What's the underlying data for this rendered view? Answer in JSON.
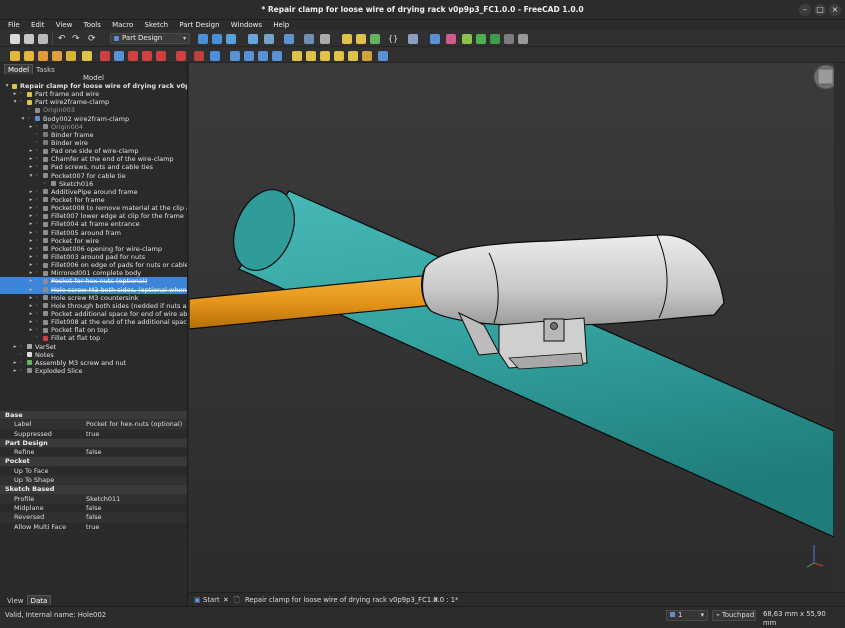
{
  "window": {
    "title": "* Repair clamp for loose wire of drying rack v0p9p3_FC1.0.0 - FreeCAD 1.0.0",
    "minimize": "–",
    "maximize": "□",
    "close": "×"
  },
  "menu": [
    "File",
    "Edit",
    "View",
    "Tools",
    "Macro",
    "Sketch",
    "Part Design",
    "Windows",
    "Help"
  ],
  "toolbar": {
    "workbench": "Part Design"
  },
  "panel_tabs": {
    "model": "Model",
    "tasks": "Tasks"
  },
  "tree_header": "Model",
  "tree": [
    {
      "label": "Repair clamp for loose wire of drying rack v0p9p3_...",
      "bold": true
    },
    {
      "label": "Part frame and wire"
    },
    {
      "label": "Part wire2frame-clamp"
    },
    {
      "label": "Origin003"
    },
    {
      "label": "Body002 wire2fram-clamp"
    },
    {
      "label": "Origin004"
    },
    {
      "label": "Binder frame"
    },
    {
      "label": "Binder wire"
    },
    {
      "label": "Pad one side of wire-clamp"
    },
    {
      "label": "Chamfer at the end of the wire-clamp"
    },
    {
      "label": "Pad screws, nuts and cable ties"
    },
    {
      "label": "Pocket007 for cable tie"
    },
    {
      "label": "Sketch016"
    },
    {
      "label": "AdditivePipe around frame"
    },
    {
      "label": "Pocket for frame"
    },
    {
      "label": "Pocket008 to remove material at the clip a..."
    },
    {
      "label": "Fillet007 lower edge at clip for the frame"
    },
    {
      "label": "Fillet004 at frame entrance"
    },
    {
      "label": "Fillet005 around fram"
    },
    {
      "label": "Pocket for wire"
    },
    {
      "label": "Pocket006 opening for wire-clamp"
    },
    {
      "label": "Fillet003 around pad for nuts"
    },
    {
      "label": "Fillet006 on edge of pads for nuts or cable..."
    },
    {
      "label": "Mirrored001 complete body"
    },
    {
      "label": "Pocket for hex-nuts (optional)"
    },
    {
      "label": "Hole screw M3 both sides, (optional when ..."
    },
    {
      "label": "Hole screw M3 countersink"
    },
    {
      "label": "Hole through both sides (nedded if nuts ar..."
    },
    {
      "label": "Pocket additional space for end of wire ab..."
    },
    {
      "label": "Fillet008 at the end of the additional space"
    },
    {
      "label": "Pocket flat on top"
    },
    {
      "label": "Fillet at flat top"
    },
    {
      "label": "VarSet"
    },
    {
      "label": "Notes"
    },
    {
      "label": "Assembly M3 screw and nut"
    },
    {
      "label": "Exploded Slice"
    }
  ],
  "properties": [
    {
      "group": "Base"
    },
    {
      "key": "Label",
      "value": "Pocket for hex-nuts (optional)"
    },
    {
      "key": "Suppressed",
      "value": "true"
    },
    {
      "group": "Part Design"
    },
    {
      "key": "Refine",
      "value": "false"
    },
    {
      "group": "Pocket"
    },
    {
      "key": "Up To Face",
      "value": ""
    },
    {
      "key": "Up To Shape",
      "value": ""
    },
    {
      "group": "Sketch Based"
    },
    {
      "key": "Profile",
      "value": "Sketch011"
    },
    {
      "key": "Midplane",
      "value": "false"
    },
    {
      "key": "Reversed",
      "value": "false"
    },
    {
      "key": "Allow Multi Face",
      "value": "true"
    }
  ],
  "bottom_tabs": {
    "view": "View",
    "data": "Data"
  },
  "doc_tabs": {
    "start": "Start",
    "document": "Repair clamp for loose wire of drying rack v0p9p3_FC1.0.0 : 1*"
  },
  "status": {
    "message": "Valid, Internal name: Hole002",
    "page": "1",
    "nav": "Touchpad",
    "dimensions": "68,63 mm x 55,90 mm"
  },
  "colors": {
    "frame_cyan": "#3aa6a3",
    "wire_orange": "#e79a12",
    "clamp_grey": "#d0d0d0",
    "selection_blue": "#3d85d8"
  }
}
